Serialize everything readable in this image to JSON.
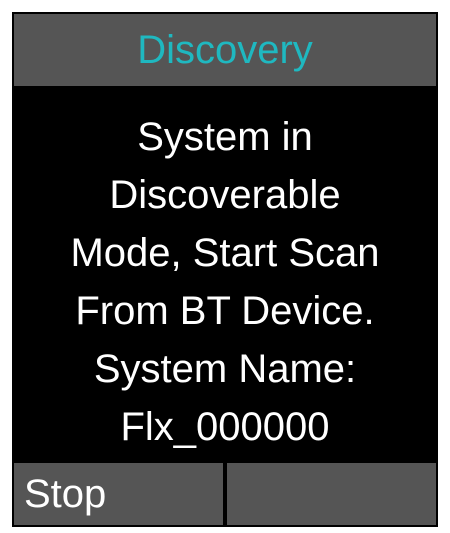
{
  "header": {
    "title": "Discovery",
    "title_color": "#1fb8c0"
  },
  "message": {
    "lines": [
      "System in",
      "Discoverable",
      "Mode, Start Scan",
      "From BT Device.",
      "System Name:",
      "Flx_000000"
    ]
  },
  "softkeys": {
    "left_label": "Stop",
    "right_label": ""
  },
  "colors": {
    "bar_background": "#555555",
    "screen_background": "#000000",
    "text": "#ffffff"
  }
}
